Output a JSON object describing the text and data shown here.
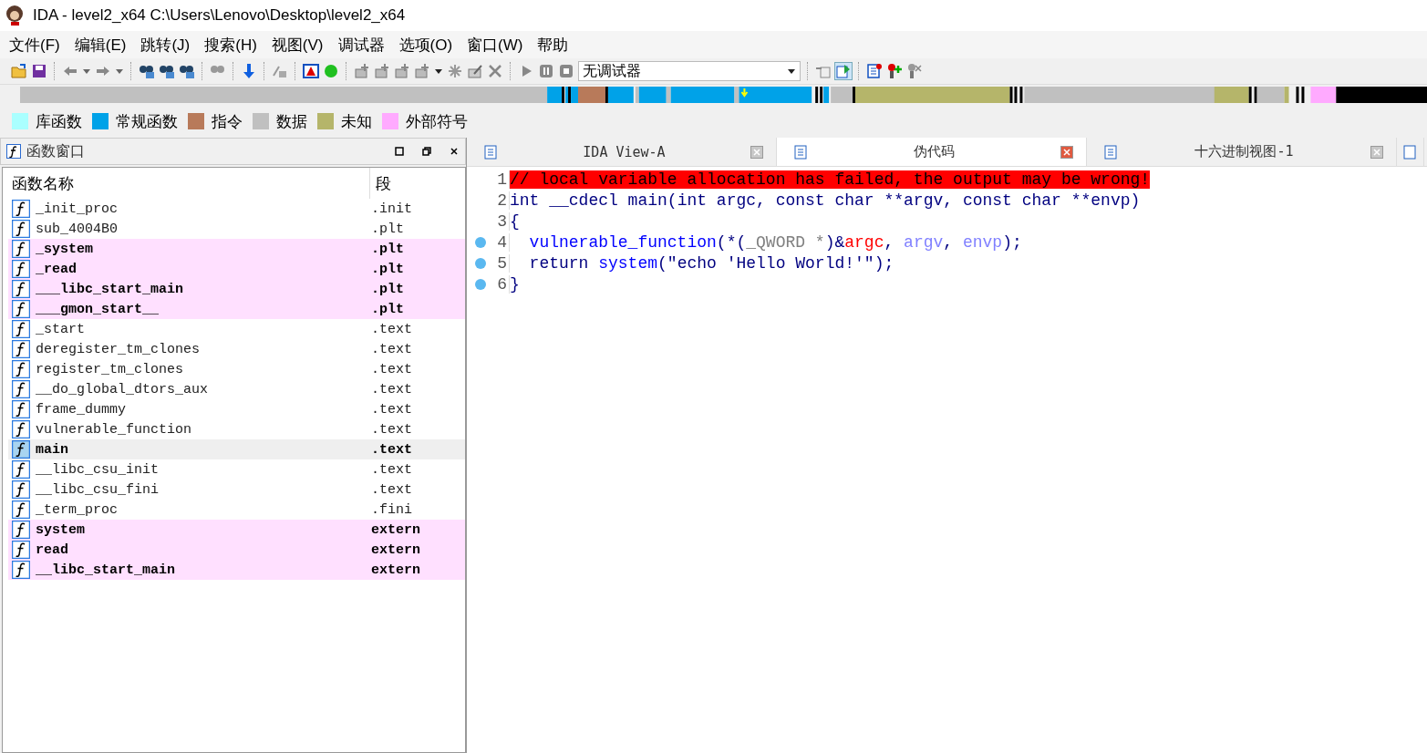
{
  "window": {
    "title": "IDA - level2_x64 C:\\Users\\Lenovo\\Desktop\\level2_x64"
  },
  "menu": [
    "文件(F)",
    "编辑(E)",
    "跳转(J)",
    "搜索(H)",
    "视图(V)",
    "调试器",
    "选项(O)",
    "窗口(W)",
    "帮助"
  ],
  "toolbar": {
    "debugger": "无调试器"
  },
  "legend": [
    {
      "label": "库函数",
      "color": "#aaffff"
    },
    {
      "label": "常规函数",
      "color": "#00a2e8"
    },
    {
      "label": "指令",
      "color": "#b87a5a"
    },
    {
      "label": "数据",
      "color": "#c0c0c0"
    },
    {
      "label": "未知",
      "color": "#b5b56a"
    },
    {
      "label": "外部符号",
      "color": "#ffaaff"
    }
  ],
  "functions_window": {
    "title": "函数窗口",
    "columns": [
      "函数名称",
      "段"
    ],
    "rows": [
      {
        "name": "_init_proc",
        "segment": ".init",
        "imported": false,
        "selected": false
      },
      {
        "name": "sub_4004B0",
        "segment": ".plt",
        "imported": false,
        "selected": false
      },
      {
        "name": "_system",
        "segment": ".plt",
        "imported": true,
        "selected": false
      },
      {
        "name": "_read",
        "segment": ".plt",
        "imported": true,
        "selected": false
      },
      {
        "name": "___libc_start_main",
        "segment": ".plt",
        "imported": true,
        "selected": false
      },
      {
        "name": "___gmon_start__",
        "segment": ".plt",
        "imported": true,
        "selected": false
      },
      {
        "name": "_start",
        "segment": ".text",
        "imported": false,
        "selected": false
      },
      {
        "name": "deregister_tm_clones",
        "segment": ".text",
        "imported": false,
        "selected": false
      },
      {
        "name": "register_tm_clones",
        "segment": ".text",
        "imported": false,
        "selected": false
      },
      {
        "name": "__do_global_dtors_aux",
        "segment": ".text",
        "imported": false,
        "selected": false
      },
      {
        "name": "frame_dummy",
        "segment": ".text",
        "imported": false,
        "selected": false
      },
      {
        "name": "vulnerable_function",
        "segment": ".text",
        "imported": false,
        "selected": false
      },
      {
        "name": "main",
        "segment": ".text",
        "imported": false,
        "selected": true
      },
      {
        "name": "__libc_csu_init",
        "segment": ".text",
        "imported": false,
        "selected": false
      },
      {
        "name": "__libc_csu_fini",
        "segment": ".text",
        "imported": false,
        "selected": false
      },
      {
        "name": "_term_proc",
        "segment": ".fini",
        "imported": false,
        "selected": false
      },
      {
        "name": "system",
        "segment": "extern",
        "imported": true,
        "selected": false
      },
      {
        "name": "read",
        "segment": "extern",
        "imported": true,
        "selected": false
      },
      {
        "name": "__libc_start_main",
        "segment": "extern",
        "imported": true,
        "selected": false
      }
    ]
  },
  "tabs": [
    {
      "label": "IDA View-A",
      "selected": false
    },
    {
      "label": "伪代码",
      "selected": true
    },
    {
      "label": "十六进制视图-1",
      "selected": false
    }
  ],
  "code": [
    {
      "num": "1",
      "breakpoint": false,
      "tokens": [
        {
          "kind": "warning",
          "text": "// local variable allocation has failed, the output may be wrong!"
        }
      ]
    },
    {
      "num": "2",
      "breakpoint": false,
      "tokens": [
        {
          "kind": "plain",
          "text": "int __cdecl main(int argc, const char **argv, const char **envp)"
        }
      ]
    },
    {
      "num": "3",
      "breakpoint": false,
      "tokens": [
        {
          "kind": "plain",
          "text": "{"
        }
      ]
    },
    {
      "num": "4",
      "breakpoint": true,
      "indent": true,
      "tokens": [
        {
          "kind": "function",
          "text": "vulnerable_function"
        },
        {
          "kind": "plain",
          "text": "(*("
        },
        {
          "kind": "type",
          "text": "_QWORD *"
        },
        {
          "kind": "plain",
          "text": ")&"
        },
        {
          "kind": "argument",
          "text": "argc"
        },
        {
          "kind": "plain",
          "text": ", "
        },
        {
          "kind": "variable",
          "text": "argv"
        },
        {
          "kind": "plain",
          "text": ", "
        },
        {
          "kind": "variable",
          "text": "envp"
        },
        {
          "kind": "plain",
          "text": ");"
        }
      ]
    },
    {
      "num": "5",
      "breakpoint": true,
      "indent": true,
      "tokens": [
        {
          "kind": "plain",
          "text": "return "
        },
        {
          "kind": "function",
          "text": "system"
        },
        {
          "kind": "plain",
          "text": "(\"echo 'Hello World!'\");"
        }
      ]
    },
    {
      "num": "6",
      "breakpoint": true,
      "tokens": [
        {
          "kind": "plain",
          "text": "}"
        }
      ]
    }
  ]
}
